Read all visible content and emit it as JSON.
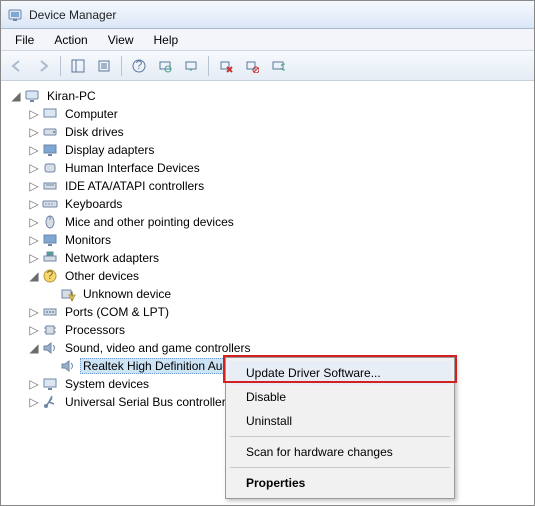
{
  "window": {
    "title": "Device Manager"
  },
  "menu": {
    "file": "File",
    "action": "Action",
    "view": "View",
    "help": "Help"
  },
  "tree": {
    "root": "Kiran-PC",
    "computer": "Computer",
    "disk": "Disk drives",
    "display": "Display adapters",
    "hid": "Human Interface Devices",
    "ide": "IDE ATA/ATAPI controllers",
    "keyboards": "Keyboards",
    "mice": "Mice and other pointing devices",
    "monitors": "Monitors",
    "network": "Network adapters",
    "other": "Other devices",
    "unknown": "Unknown device",
    "ports": "Ports (COM & LPT)",
    "processors": "Processors",
    "sound": "Sound, video and game controllers",
    "realtek": "Realtek High Definition Audio",
    "system": "System devices",
    "usb": "Universal Serial Bus controllers"
  },
  "context": {
    "update": "Update Driver Software...",
    "disable": "Disable",
    "uninstall": "Uninstall",
    "scan": "Scan for hardware changes",
    "properties": "Properties"
  }
}
